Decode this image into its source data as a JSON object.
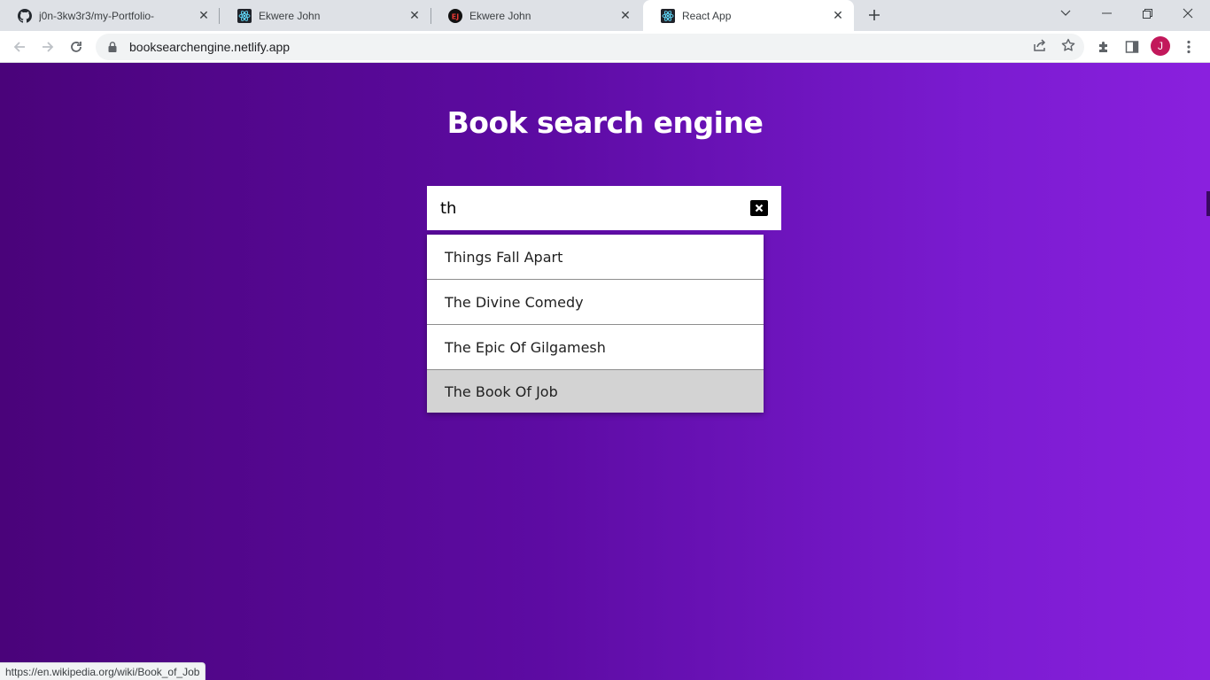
{
  "browser": {
    "tabs": [
      {
        "title": "j0n-3kw3r3/my-Portfolio-",
        "icon": "github-icon",
        "active": false
      },
      {
        "title": "Ekwere John",
        "icon": "react-icon",
        "active": false
      },
      {
        "title": "Ekwere John",
        "icon": "ej-logo-icon",
        "active": false
      },
      {
        "title": "React App",
        "icon": "react-icon",
        "active": true
      }
    ],
    "url": "booksearchengine.netlify.app",
    "profile_initial": "J",
    "profile_color": "#c2185b"
  },
  "page": {
    "heading": "Book search engine",
    "search": {
      "value": "th"
    },
    "results": [
      {
        "title": "Things Fall Apart"
      },
      {
        "title": "The Divine Comedy"
      },
      {
        "title": "The Epic Of Gilgamesh"
      },
      {
        "title": "The Book Of Job",
        "hovered": true
      }
    ],
    "gradient_start": "#4a037a",
    "gradient_end": "#8a20de"
  },
  "status_bar": {
    "link": "https://en.wikipedia.org/wiki/Book_of_Job"
  }
}
